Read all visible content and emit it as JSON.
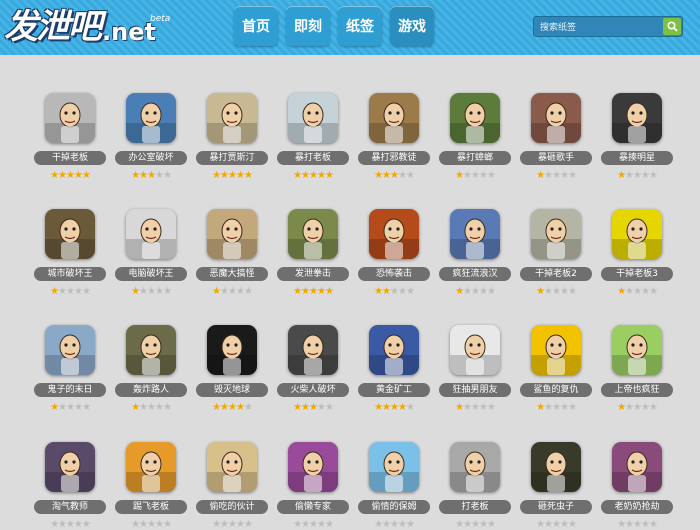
{
  "logo": {
    "text_cn": "发泄吧",
    "text_net": ".net",
    "badge": "beta"
  },
  "nav": [
    {
      "label": "首页"
    },
    {
      "label": "即刻"
    },
    {
      "label": "纸签"
    },
    {
      "label": "游戏"
    }
  ],
  "search": {
    "placeholder": "搜索纸签"
  },
  "colors": {
    "header": "#3aa8dc",
    "label_bg": "#6f6f6f",
    "star_on": "#f0a800",
    "star_off": "#bdbdbd",
    "search_btn": "#7cc242"
  },
  "games": [
    {
      "title": "干掉老板",
      "rating": 5,
      "icon": "boss-sketch",
      "bg": "#b8b8b8"
    },
    {
      "title": "办公室破坏",
      "rating": 3,
      "icon": "office-man",
      "bg": "#4a7fb5"
    },
    {
      "title": "暴打贾斯汀",
      "rating": 5,
      "icon": "justin",
      "bg": "#c9b993"
    },
    {
      "title": "暴打老板",
      "rating": 5,
      "icon": "boss-tie",
      "bg": "#c5d2d8"
    },
    {
      "title": "暴打邪教徒",
      "rating": 3,
      "icon": "cultist",
      "bg": "#9c7a4a"
    },
    {
      "title": "暴打蟑螂",
      "rating": 1,
      "icon": "cockroach",
      "bg": "#5b7c3a"
    },
    {
      "title": "暴砸歌手",
      "rating": 1,
      "icon": "singer",
      "bg": "#8a5a4a"
    },
    {
      "title": "暴揍明星",
      "rating": 1,
      "icon": "star-celeb",
      "bg": "#3a3a3a"
    },
    {
      "title": "城市破坏王",
      "rating": 1,
      "icon": "city-monster",
      "bg": "#6b5a3a"
    },
    {
      "title": "电脑破坏王",
      "rating": 1,
      "icon": "computer",
      "bg": "#d8d8d8"
    },
    {
      "title": "恶魔大搞怪",
      "rating": 1,
      "icon": "devil-lab",
      "bg": "#c2a87a"
    },
    {
      "title": "发泄拳击",
      "rating": 5,
      "icon": "boxer",
      "bg": "#7a8a4a"
    },
    {
      "title": "恐怖袭击",
      "rating": 2,
      "icon": "mad-maker",
      "bg": "#b54a1a"
    },
    {
      "title": "疯狂流浪汉",
      "rating": 1,
      "icon": "hobo",
      "bg": "#5a7ab5"
    },
    {
      "title": "干掉老板2",
      "rating": 1,
      "icon": "boss-2",
      "bg": "#b5b5a5"
    },
    {
      "title": "干掉老板3",
      "rating": 1,
      "icon": "boss-3",
      "bg": "#e5d500"
    },
    {
      "title": "鬼子的末日",
      "rating": 1,
      "icon": "soldier",
      "bg": "#8aa8c8"
    },
    {
      "title": "轰炸路人",
      "rating": 1,
      "icon": "bomb-street",
      "bg": "#6b6b4a"
    },
    {
      "title": "毁灭地球",
      "rating": 4,
      "icon": "earth-blast",
      "bg": "#1a1a1a"
    },
    {
      "title": "火柴人破坏",
      "rating": 3,
      "icon": "stickman",
      "bg": "#4a4a4a"
    },
    {
      "title": "黄金矿工",
      "rating": 4,
      "icon": "gold-miner",
      "bg": "#3a5aa5"
    },
    {
      "title": "狂抽男朋友",
      "rating": 1,
      "icon": "slap-bf",
      "bg": "#e8e8e8"
    },
    {
      "title": "鲨鱼的复仇",
      "rating": 1,
      "icon": "shark-sign",
      "bg": "#f2c200"
    },
    {
      "title": "上帝也疯狂",
      "rating": 1,
      "icon": "god-hand",
      "bg": "#9acd62"
    },
    {
      "title": "淘气教师",
      "rating": 0,
      "icon": "teacher",
      "bg": "#5a4a6a"
    },
    {
      "title": "踢飞老板",
      "rating": 0,
      "icon": "old-boss",
      "bg": "#e59a2a"
    },
    {
      "title": "偷吃的伙计",
      "rating": 0,
      "icon": "eater",
      "bg": "#d8c08a"
    },
    {
      "title": "偷懒专家",
      "rating": 0,
      "icon": "lazy",
      "bg": "#9a4a9a"
    },
    {
      "title": "偷情的保姆",
      "rating": 0,
      "icon": "nanny",
      "bg": "#7ac0e8"
    },
    {
      "title": "打老板",
      "rating": 0,
      "icon": "hit-boss",
      "bg": "#a8a8a8"
    },
    {
      "title": "砸死虫子",
      "rating": 0,
      "icon": "bug-hammer",
      "bg": "#3a3a2a"
    },
    {
      "title": "老奶奶抢劫",
      "rating": 0,
      "icon": "granny",
      "bg": "#8a4a7a"
    }
  ]
}
